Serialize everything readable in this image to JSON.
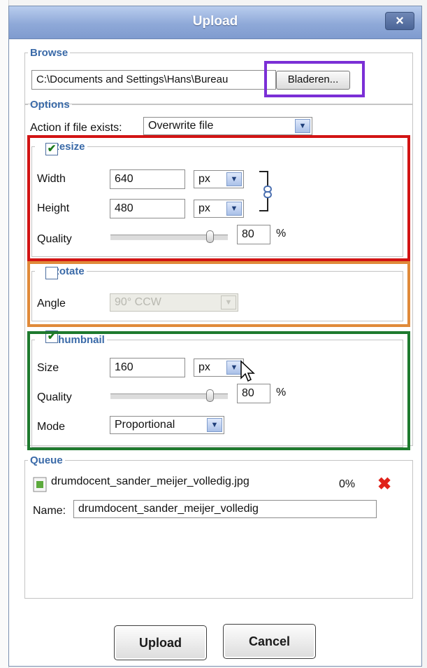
{
  "dialog": {
    "title": "Upload",
    "close_symbol": "×"
  },
  "browse": {
    "legend": "Browse",
    "path_value": "C:\\Documents and Settings\\Hans\\Bureau",
    "browse_label": "Bladeren..."
  },
  "options": {
    "legend": "Options",
    "action_label": "Action if file exists:",
    "action_value": "Overwrite file"
  },
  "resize": {
    "legend": "Resize",
    "checked": true,
    "width_label": "Width",
    "width_value": "640",
    "width_unit": "px",
    "height_label": "Height",
    "height_value": "480",
    "height_unit": "px",
    "quality_label": "Quality",
    "quality_value": "80",
    "quality_percent": "%"
  },
  "rotate": {
    "legend": "Rotate",
    "checked": false,
    "angle_label": "Angle",
    "angle_value": "90° CCW"
  },
  "thumbnail": {
    "legend": "Thumbnail",
    "checked": true,
    "size_label": "Size",
    "size_value": "160",
    "size_unit": "px",
    "quality_label": "Quality",
    "quality_value": "80",
    "quality_percent": "%",
    "mode_label": "Mode",
    "mode_value": "Proportional"
  },
  "queue": {
    "legend": "Queue",
    "file_name": "drumdocent_sander_meijer_volledig.jpg",
    "progress": "0%",
    "name_label": "Name:",
    "name_value": "drumdocent_sander_meijer_volledig"
  },
  "footer": {
    "upload_label": "Upload",
    "cancel_label": "Cancel"
  },
  "icons": {
    "checkmark": "✔",
    "dropdown": "▼",
    "remove": "✖",
    "chain": "link-icon",
    "file": "image-file-icon"
  },
  "highlight_colors": {
    "browse_button": "#7b2fd6",
    "resize": "#d21414",
    "rotate": "#e08a3a",
    "thumbnail": "#1e7a2e"
  }
}
